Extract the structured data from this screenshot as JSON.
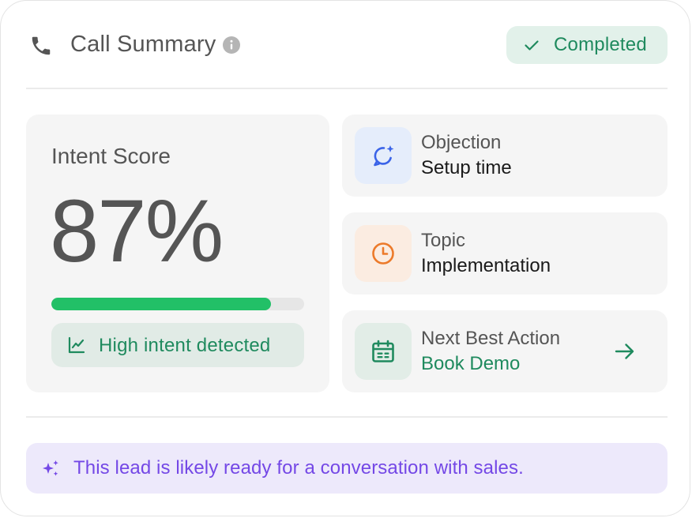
{
  "header": {
    "title": "Call Summary",
    "status": "Completed",
    "icons": {
      "phone": "phone-icon",
      "info": "info-icon",
      "status": "check-icon"
    }
  },
  "intent": {
    "label": "Intent Score",
    "value": "87%",
    "progress_fraction": 0.87,
    "badge": "High intent detected",
    "badge_icon": "trend-chart-icon"
  },
  "cards": {
    "objection": {
      "label": "Objection",
      "value": "Setup time",
      "icon": "chat-sparkle-icon"
    },
    "topic": {
      "label": "Topic",
      "value": "Implementation",
      "icon": "clock-icon"
    },
    "action": {
      "label": "Next Best Action",
      "value": "Book Demo",
      "icon": "calendar-icon",
      "arrow_icon": "arrow-right-icon"
    }
  },
  "insight": {
    "text": "This lead is likely ready for a conversation with sales.",
    "icon": "sparkle-icon"
  },
  "colors": {
    "green_accent": "#1f8a5e",
    "progress_green": "#22c067",
    "blue_accent": "#3a63e8",
    "orange_accent": "#ec7a2a",
    "purple_accent": "#7448e6"
  }
}
